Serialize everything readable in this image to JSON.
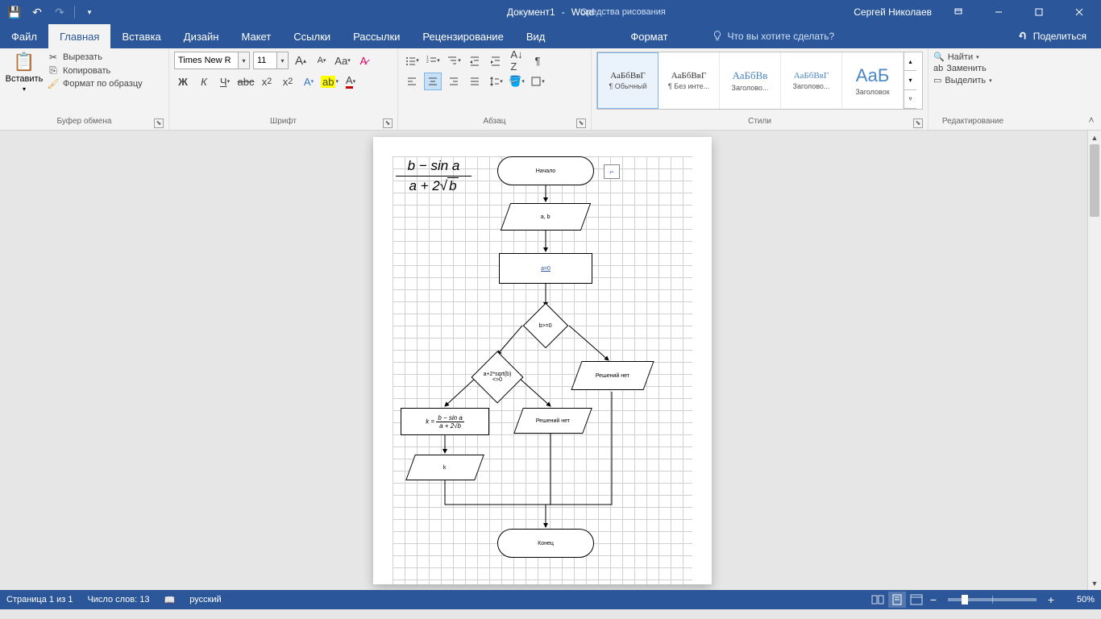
{
  "title": {
    "doc": "Документ1",
    "app": "Word",
    "context_tab": "Средства рисования",
    "user": "Сергей Николаев"
  },
  "tabs": {
    "file": "Файл",
    "home": "Главная",
    "insert": "Вставка",
    "design": "Дизайн",
    "layout": "Макет",
    "references": "Ссылки",
    "mailings": "Рассылки",
    "review": "Рецензирование",
    "view": "Вид",
    "format": "Формат"
  },
  "tell_me": "Что вы хотите сделать?",
  "share": "Поделиться",
  "clipboard": {
    "label": "Буфер обмена",
    "paste": "Вставить",
    "cut": "Вырезать",
    "copy": "Копировать",
    "format_painter": "Формат по образцу"
  },
  "font": {
    "label": "Шрифт",
    "name": "Times New R",
    "size": "11"
  },
  "paragraph": {
    "label": "Абзац"
  },
  "styles": {
    "label": "Стили",
    "items": [
      {
        "preview": "АаБбВвГ",
        "name": "¶ Обычный"
      },
      {
        "preview": "АаБбВвГ",
        "name": "¶ Без инте..."
      },
      {
        "preview": "АаБбВв",
        "name": "Заголово..."
      },
      {
        "preview": "АаБбВвГ",
        "name": "Заголово..."
      },
      {
        "preview": "АаБ",
        "name": "Заголовок"
      }
    ]
  },
  "editing": {
    "label": "Редактирование",
    "find": "Найти",
    "replace": "Заменить",
    "select": "Выделить"
  },
  "flow": {
    "start": "Начало",
    "input": "a, b",
    "process": "a=0",
    "decision1": "b>=0",
    "decision2": "a+2*sqrt(b)<>0",
    "no_solution1": "Решений нет",
    "no_solution2": "Решений нет",
    "output_k": "k",
    "formula_top": "b − sin a",
    "formula_bot_a": "a + 2",
    "formula_bot_b": "b",
    "process2_top": "b − sin a",
    "process2_bot": "a + 2√b",
    "end": "Конец"
  },
  "status": {
    "page": "Страница 1 из 1",
    "words": "Число слов: 13",
    "lang": "русский",
    "zoom": "50%"
  }
}
